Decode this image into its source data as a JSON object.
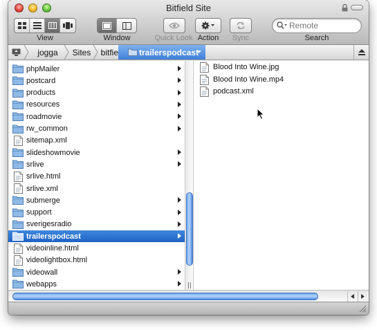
{
  "window": {
    "title": "Bitfield Site"
  },
  "toolbar": {
    "view_label": "View",
    "window_label": "Window",
    "quicklook_label": "Quick Look",
    "action_label": "Action",
    "sync_label": "Sync",
    "search_label": "Search",
    "search_placeholder": "Remote"
  },
  "pathbar": {
    "crumbs": [
      "jogga",
      "Sites",
      "bitfield",
      "trailerspodcast"
    ]
  },
  "column1": {
    "items": [
      {
        "name": "phpMailer",
        "type": "folder",
        "has_children": true
      },
      {
        "name": "postcard",
        "type": "folder",
        "has_children": true
      },
      {
        "name": "products",
        "type": "folder",
        "has_children": true
      },
      {
        "name": "resources",
        "type": "folder",
        "has_children": true
      },
      {
        "name": "roadmovie",
        "type": "folder",
        "has_children": true
      },
      {
        "name": "rw_common",
        "type": "folder",
        "has_children": true
      },
      {
        "name": "sitemap.xml",
        "type": "file",
        "has_children": false
      },
      {
        "name": "slideshowmovie",
        "type": "folder",
        "has_children": true
      },
      {
        "name": "srlive",
        "type": "folder",
        "has_children": true
      },
      {
        "name": "srlive.html",
        "type": "file",
        "has_children": false
      },
      {
        "name": "srlive.xml",
        "type": "file",
        "has_children": false
      },
      {
        "name": "submerge",
        "type": "folder",
        "has_children": true
      },
      {
        "name": "support",
        "type": "folder",
        "has_children": true
      },
      {
        "name": "sverigesradio",
        "type": "folder",
        "has_children": true
      },
      {
        "name": "trailerspodcast",
        "type": "folder",
        "has_children": true,
        "selected": true
      },
      {
        "name": "videoinline.html",
        "type": "file",
        "has_children": false
      },
      {
        "name": "videolightbox.html",
        "type": "file",
        "has_children": false
      },
      {
        "name": "videowall",
        "type": "folder",
        "has_children": true
      },
      {
        "name": "webapps",
        "type": "folder",
        "has_children": true
      }
    ]
  },
  "column2": {
    "items": [
      {
        "name": "Blood Into Wine.jpg",
        "type": "file"
      },
      {
        "name": "Blood Into Wine.mp4",
        "type": "file"
      },
      {
        "name": "podcast.xml",
        "type": "file"
      }
    ]
  },
  "colors": {
    "selection": "#2a6fce",
    "folder": "#8fb9e6",
    "scroll_thumb": "#5b97e4"
  }
}
